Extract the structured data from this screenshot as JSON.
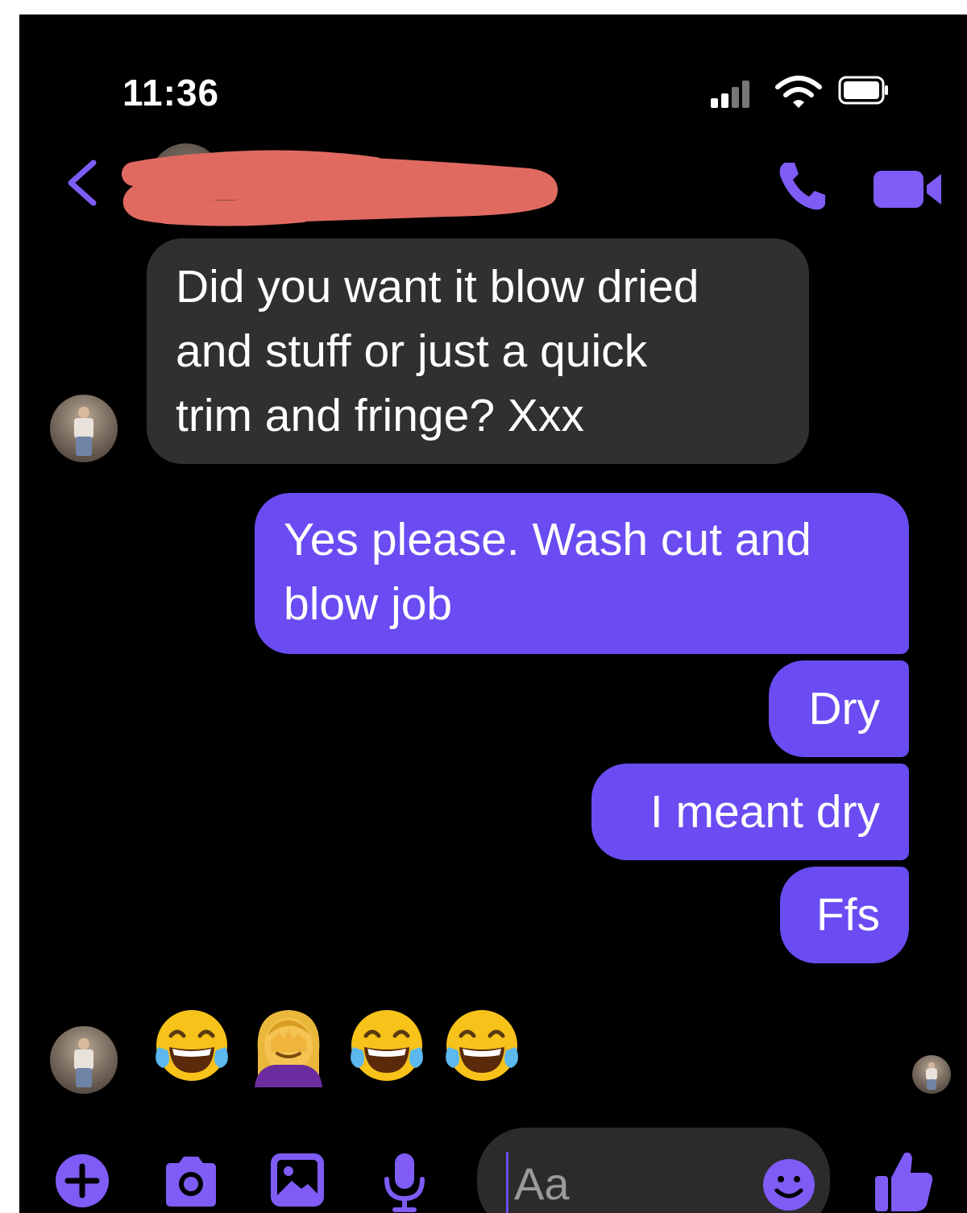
{
  "status_bar": {
    "time": "11:36",
    "icons": [
      "cellular-signal-icon",
      "wifi-icon",
      "battery-icon"
    ]
  },
  "header": {
    "contact_name_redacted": true,
    "icons": [
      "back-chevron-icon",
      "phone-icon",
      "video-camera-icon"
    ]
  },
  "colors": {
    "background": "#000000",
    "incoming_bubble": "#303030",
    "outgoing_bubble": "#6a4cf2",
    "accent": "#7e5cf5",
    "redaction": "#e06a60"
  },
  "messages": [
    {
      "direction": "incoming",
      "lines": [
        "Did you want it blow dried",
        "and stuff or just a quick",
        "trim and fringe? Xxx"
      ]
    },
    {
      "direction": "outgoing",
      "lines": [
        "Yes please. Wash cut and",
        "blow job"
      ]
    },
    {
      "direction": "outgoing",
      "text": "Dry"
    },
    {
      "direction": "outgoing",
      "text": "I meant dry"
    },
    {
      "direction": "outgoing",
      "text": "Ffs"
    }
  ],
  "emoji_reply": {
    "direction": "incoming",
    "emojis": [
      "face-with-tears-of-joy",
      "person-facepalming",
      "face-with-tears-of-joy",
      "face-with-tears-of-joy"
    ]
  },
  "composer": {
    "placeholder": "Aa",
    "icons": [
      "plus-icon",
      "camera-icon",
      "gallery-icon",
      "microphone-icon",
      "emoji-icon",
      "thumbs-up-icon"
    ]
  }
}
